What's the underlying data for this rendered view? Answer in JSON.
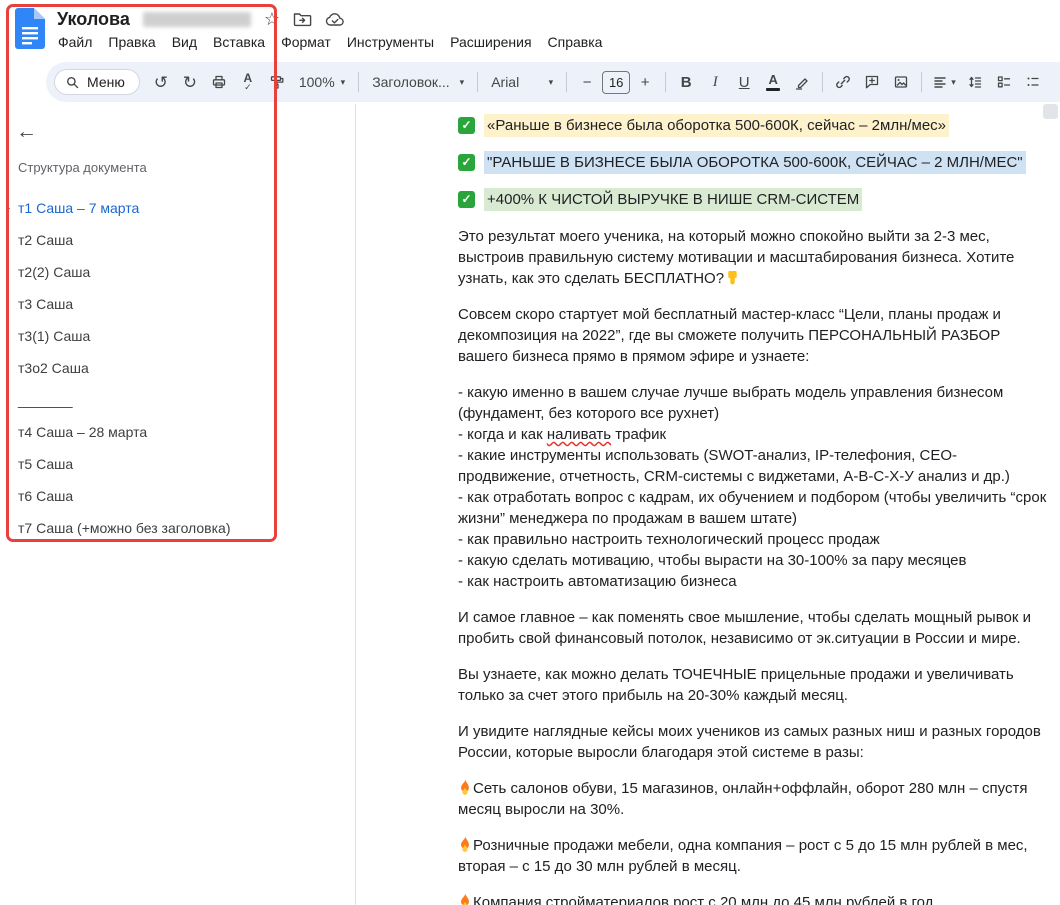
{
  "colors": {
    "annotation_red": "#e8413c",
    "accent_blue": "#1967d2",
    "toolbar_bg": "#edf2fa",
    "highlight_yellow": "#fdf2cb",
    "highlight_blue": "#cfe2f3",
    "highlight_green": "#d9ead3",
    "check_green": "#2aa53c"
  },
  "header": {
    "title": "Уколова",
    "menus": [
      "Файл",
      "Правка",
      "Вид",
      "Вставка",
      "Формат",
      "Инструменты",
      "Расширения",
      "Справка"
    ]
  },
  "toolbar": {
    "menu_label": "Меню",
    "zoom": "100%",
    "paragraph_style": "Заголовок...",
    "font_family": "Arial",
    "font_size": "16"
  },
  "icons": {
    "undo": "↺",
    "redo": "↻",
    "caret": "▾",
    "star": "☆",
    "minus": "−",
    "plus": "+",
    "back_arrow": "←",
    "bold": "B",
    "italic": "I",
    "underline": "U",
    "text_color": "A",
    "spellcheck_letter": "A",
    "check_mark": "✓",
    "outline_dash": "-"
  },
  "outline": {
    "heading": "Структура документа",
    "items": [
      "т1 Саша – 7 марта",
      "т2 Саша",
      "т2(2) Саша",
      "т3 Саша",
      "т3(1) Саша",
      "т3о2 Саша",
      "_______",
      "т4 Саша – 28 марта",
      "т5 Саша",
      "т6 Саша",
      "т7 Саша (+можно без заголовка)"
    ]
  },
  "doc": {
    "check1": "«Раньше в бизнесе была оборотка 500-600К, сейчас – 2млн/мес»",
    "check2": "\"РАНЬШЕ В БИЗНЕСЕ БЫЛА ОБОРОТКА 500-600К, СЕЙЧАС – 2 МЛН/МЕС\"",
    "check3": "+400% К ЧИСТОЙ ВЫРУЧКЕ В НИШЕ CRM-СИСТЕМ",
    "p1": "Это результат моего ученика, на который можно спокойно выйти за 2-3 мес, выстроив правильную систему мотивации и масштабирования бизнеса. Хотите узнать, как это сделать БЕСПЛАТНО?",
    "p2": "Совсем скоро стартует мой бесплатный мастер-класс “Цели, планы продаж и декомпозиция на 2022”, где вы сможете получить ПЕРСОНАЛЬНЫЙ РАЗБОР вашего бизнеса прямо в прямом эфире и узнаете:",
    "list1": "- какую именно в вашем случае лучше выбрать модель управления бизнесом (фундамент, без которого все рухнет)",
    "list2_prefix": "- когда и как ",
    "list2_word": "наливать",
    "list2_suffix": " трафик",
    "list3": "- какие инструменты использовать (SWOT-анализ, IP-телефония, СЕО-продвижение, отчетность, CRM-системы с виджетами, A-B-C-X-У анализ и др.)",
    "list4": "- как отработать вопрос с кадрам, их обучением и подбором (чтобы увеличить “срок жизни” менеджера по продажам в вашем штате)",
    "list5": "- как правильно настроить технологический процесс продаж",
    "list6": "- какую сделать мотивацию, чтобы вырасти на 30-100% за пару месяцев",
    "list7": "- как настроить автоматизацию бизнеса",
    "p4": "И самое главное – как поменять свое мышление, чтобы сделать мощный рывок и пробить свой финансовый потолок, независимо от эк.ситуации в России и мире.",
    "p5": "Вы узнаете, как можно делать ТОЧЕЧНЫЕ прицельные продажи и увеличивать только за счет этого прибыль на 20-30% каждый месяц.",
    "p6": "И увидите наглядные кейсы моих учеников из самых разных ниш и разных городов России, которые выросли благодаря этой системе в разы:",
    "case1": "Сеть салонов обуви, 15 магазинов, онлайн+оффлайн, оборот 280 млн – спустя месяц выросли на 30%.",
    "case2": "Розничные продажи мебели, одна компания – рост с 5 до 15 млн рублей в мес, вторая – с 15 до 30 млн рублей в месяц.",
    "case3": "Компания стройматериалов рост с 20 млн до 45 млн рублей в год."
  }
}
